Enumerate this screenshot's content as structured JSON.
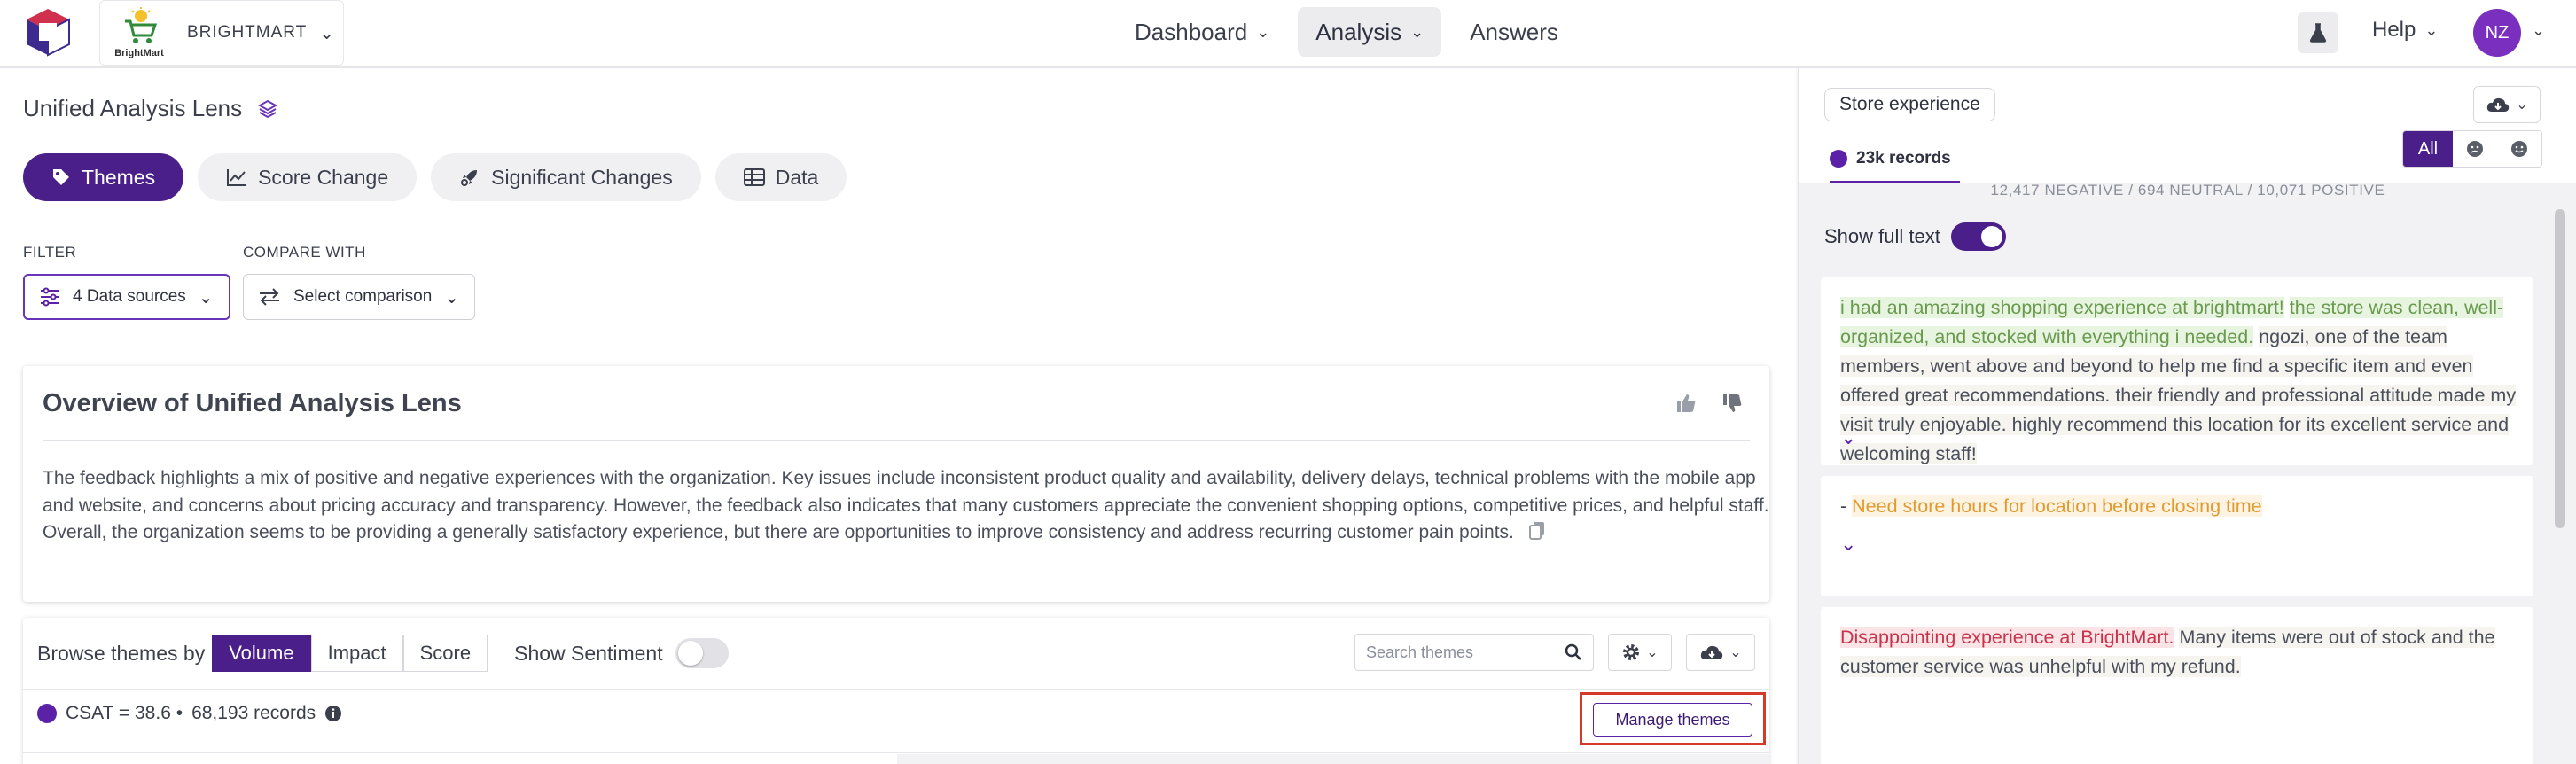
{
  "topbar": {
    "brand_name": "BRIGHTMART",
    "brand_logo_caption": "BrightMart",
    "nav": [
      {
        "label": "Dashboard",
        "active": false
      },
      {
        "label": "Analysis",
        "active": true
      },
      {
        "label": "Answers",
        "active": false
      }
    ],
    "help_label": "Help",
    "avatar_initials": "NZ"
  },
  "page": {
    "title": "Unified Analysis Lens",
    "tabs": [
      {
        "label": "Themes",
        "icon": "tag-icon",
        "active": true
      },
      {
        "label": "Score Change",
        "icon": "chart-line-icon",
        "active": false
      },
      {
        "label": "Significant Changes",
        "icon": "rocket-icon",
        "active": false
      },
      {
        "label": "Data",
        "icon": "table-icon",
        "active": false
      }
    ],
    "filter_label": "FILTER",
    "filter_value": "4 Data sources",
    "compare_label": "COMPARE WITH",
    "compare_value": "Select comparison"
  },
  "overview": {
    "title": "Overview of Unified Analysis Lens",
    "text": "The feedback highlights a mix of positive and negative experiences with the organization. Key issues include inconsistent product quality and availability, delivery delays, technical problems with the mobile app and website, and concerns about pricing accuracy and transparency. However, the feedback also indicates that many customers appreciate the convenient shopping options, competitive prices, and helpful staff. Overall, the organization seems to be providing a generally satisfactory experience, but there are opportunities to improve consistency and address recurring customer pain points."
  },
  "browse": {
    "label": "Browse themes by",
    "options": [
      "Volume",
      "Impact",
      "Score"
    ],
    "selected": "Volume",
    "show_sentiment_label": "Show Sentiment",
    "search_placeholder": "Search themes",
    "csat_text": "CSAT = 38.6 •",
    "records_text": "68,193 records",
    "manage_label": "Manage themes"
  },
  "right": {
    "chip_label": "Store experience",
    "records_tab": "23k records",
    "sentiment_filter": "All",
    "counts": "12,417 NEGATIVE / 694 NEUTRAL / 10,071 POSITIVE",
    "full_text_label": "Show full text",
    "cards": [
      {
        "pos1": "i had an amazing shopping experience at brightmart!",
        "pos2": "the store was clean, well-organized, and stocked with everything i needed.",
        "rest": "ngozi, one of the team members, went above and beyond to help me find a specific item and even offered great recommendations. their friendly and professional attitude made my visit truly enjoyable. highly recommend this location for its excellent service and welcoming staff!"
      },
      {
        "prefix": "- ",
        "warn": "Need store hours for location before closing time"
      },
      {
        "neg": "Disappointing experience at BrightMart.",
        "rest": "Many items were out of stock and the customer service was unhelpful with my refund."
      }
    ]
  },
  "colors": {
    "brand_purple": "#4b1f8a",
    "accent_purple": "#5b22a8",
    "positive": "#6a9a4f",
    "warning": "#e19a2e",
    "negative": "#c8334b",
    "highlight_box": "#d43a2a"
  }
}
